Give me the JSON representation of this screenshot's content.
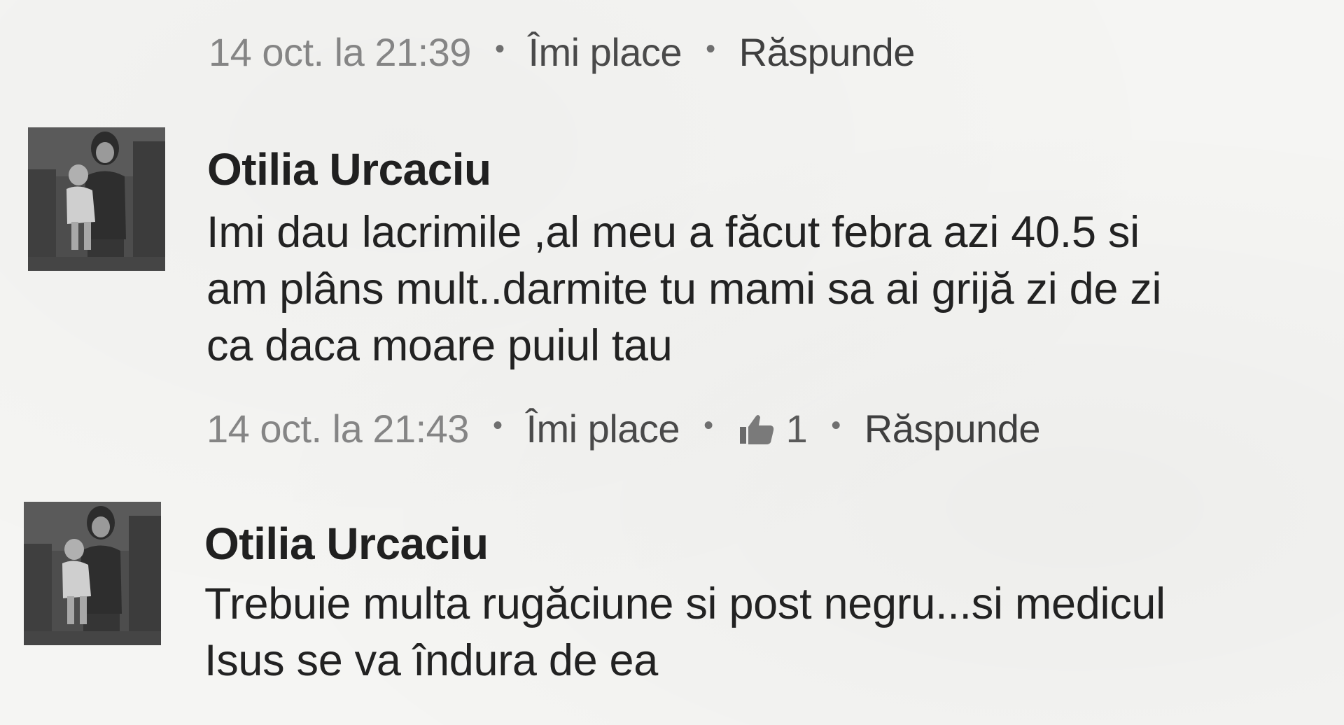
{
  "top_meta": {
    "time": "14 oct. la 21:39",
    "like_label": "Îmi place",
    "reply_label": "Răspunde"
  },
  "comments": [
    {
      "author": "Otilia Urcaciu",
      "avatar_icon": "profile-photo-icon",
      "lines": [
        "Imi dau lacrimile ,al meu a făcut febra azi 40.5 si",
        "am plâns mult..darmite tu mami sa ai grijă zi de zi",
        "ca daca moare puiul tau"
      ],
      "meta": {
        "time": "14 oct. la 21:43",
        "like_label": "Îmi place",
        "like_count": "1",
        "like_icon": "thumbs-up-icon",
        "reply_label": "Răspunde"
      }
    },
    {
      "author": "Otilia Urcaciu",
      "avatar_icon": "profile-photo-icon",
      "lines": [
        "Trebuie multa rugăciune si post negru...si medicul",
        "Isus se va îndura de ea"
      ]
    }
  ]
}
